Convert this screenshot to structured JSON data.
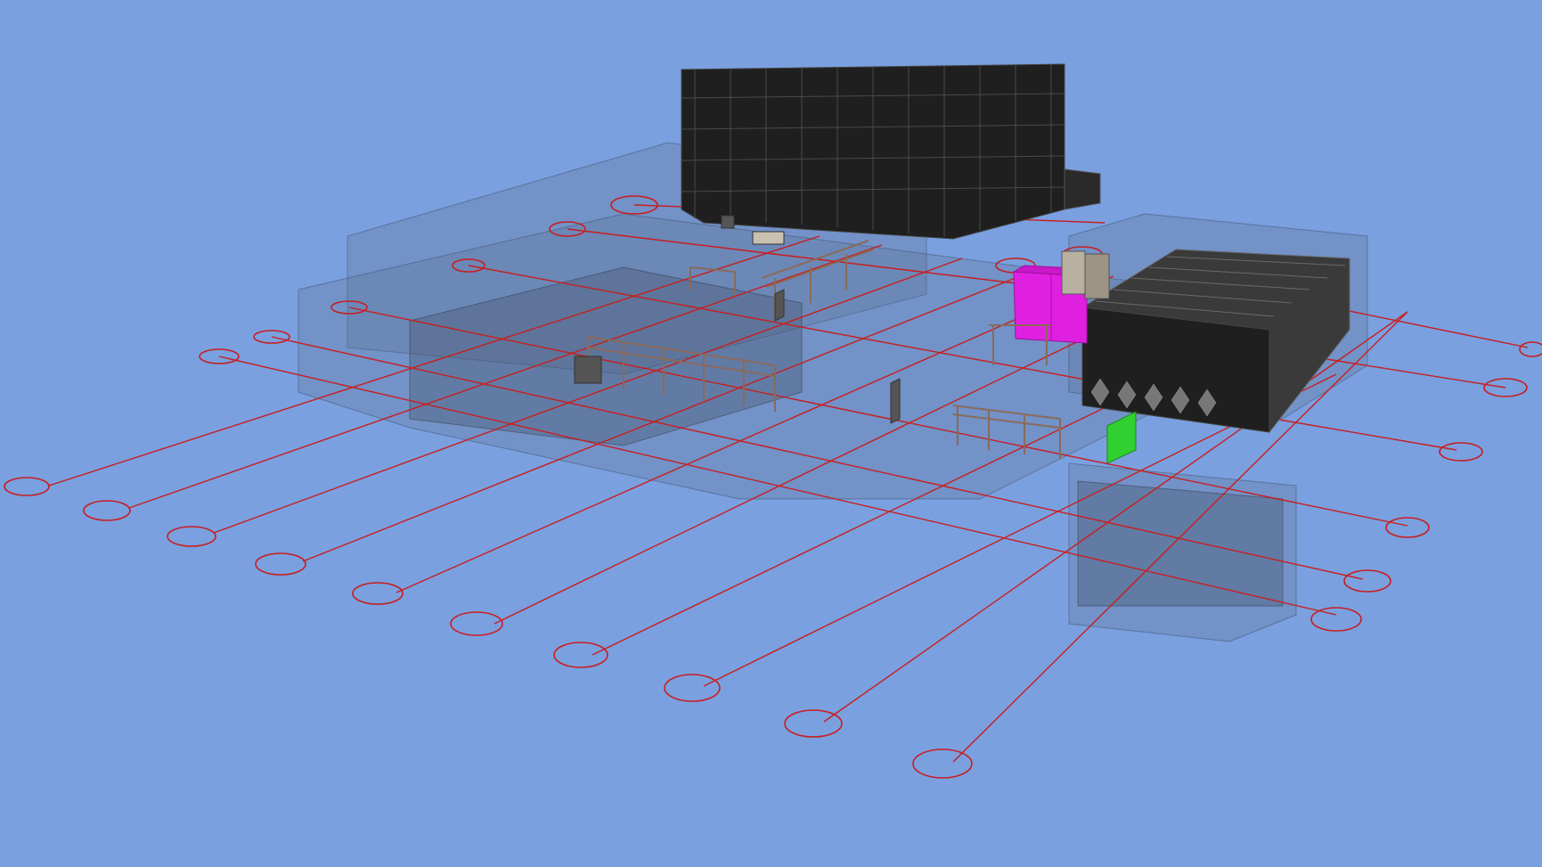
{
  "viewport": {
    "background_color": "#7aa0e0",
    "grid_line_color": "#c81e1e",
    "highlight_colors": {
      "magenta_unit": "#e020e0",
      "green_unit": "#30d030",
      "high_bay_rack": "#1f1f1f"
    }
  },
  "model_elements": {
    "high_bay_warehouse": "rack-structure",
    "small_rack_block": "rack-structure",
    "ghosted_building": "transparent-building-shell",
    "grid_bubbles": "grid-axis-marker"
  }
}
